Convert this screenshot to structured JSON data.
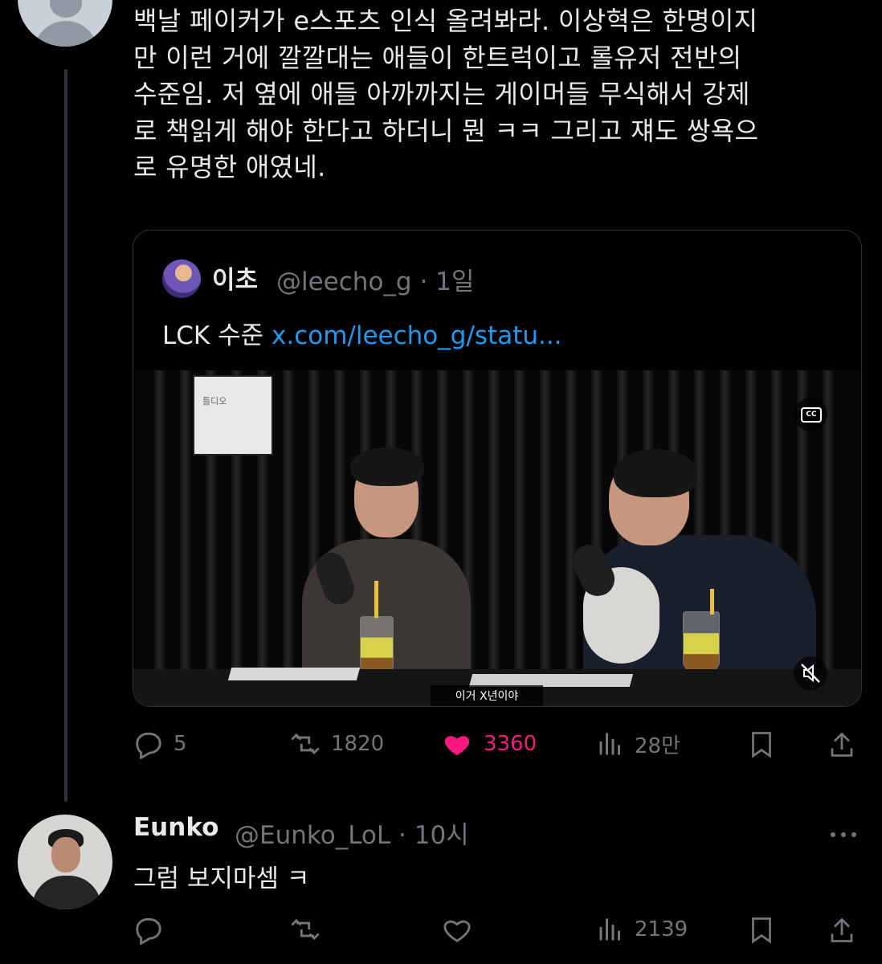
{
  "tweet": {
    "text": "백날 페이커가 e스포츠 인식 올려봐라. 이상혁은 한명이지\n만 이런 거에 깔깔대는 애들이 한트럭이고 롤유저 전반의\n수준임. 저 옆에 애들 아까까지는 게이머들 무식해서 강제\n로 책읽게 해야 한다고 하더니 뭔 ㅋㅋ 그리고 쟤도 쌍욕으\n로 유명한 애였네."
  },
  "quote": {
    "name": "이초",
    "handle_time": "@leecho_g · 1일",
    "text_prefix": "LCK 수준 ",
    "link": "x.com/leecho_g/statu...",
    "video": {
      "subtitle": "이거 X년이야",
      "poster_text": "틀디오",
      "cc_label": "CC"
    }
  },
  "tweet_actions": {
    "replies": "5",
    "reposts": "1820",
    "likes": "3360",
    "views": "28만"
  },
  "reply": {
    "name": "Eunko",
    "handle_time": "@Eunko_LoL · 10시",
    "text": "그럼 보지마셈 ㅋ",
    "views": "2139"
  },
  "colors": {
    "background": "#000000",
    "text": "#e7e9ea",
    "muted": "#71767b",
    "link": "#1d9bf0",
    "like": "#f91880"
  },
  "icons": [
    "reply-icon",
    "repost-icon",
    "like-icon",
    "views-icon",
    "bookmark-icon",
    "share-icon",
    "closed-caption-icon",
    "mute-icon",
    "more-icon"
  ]
}
